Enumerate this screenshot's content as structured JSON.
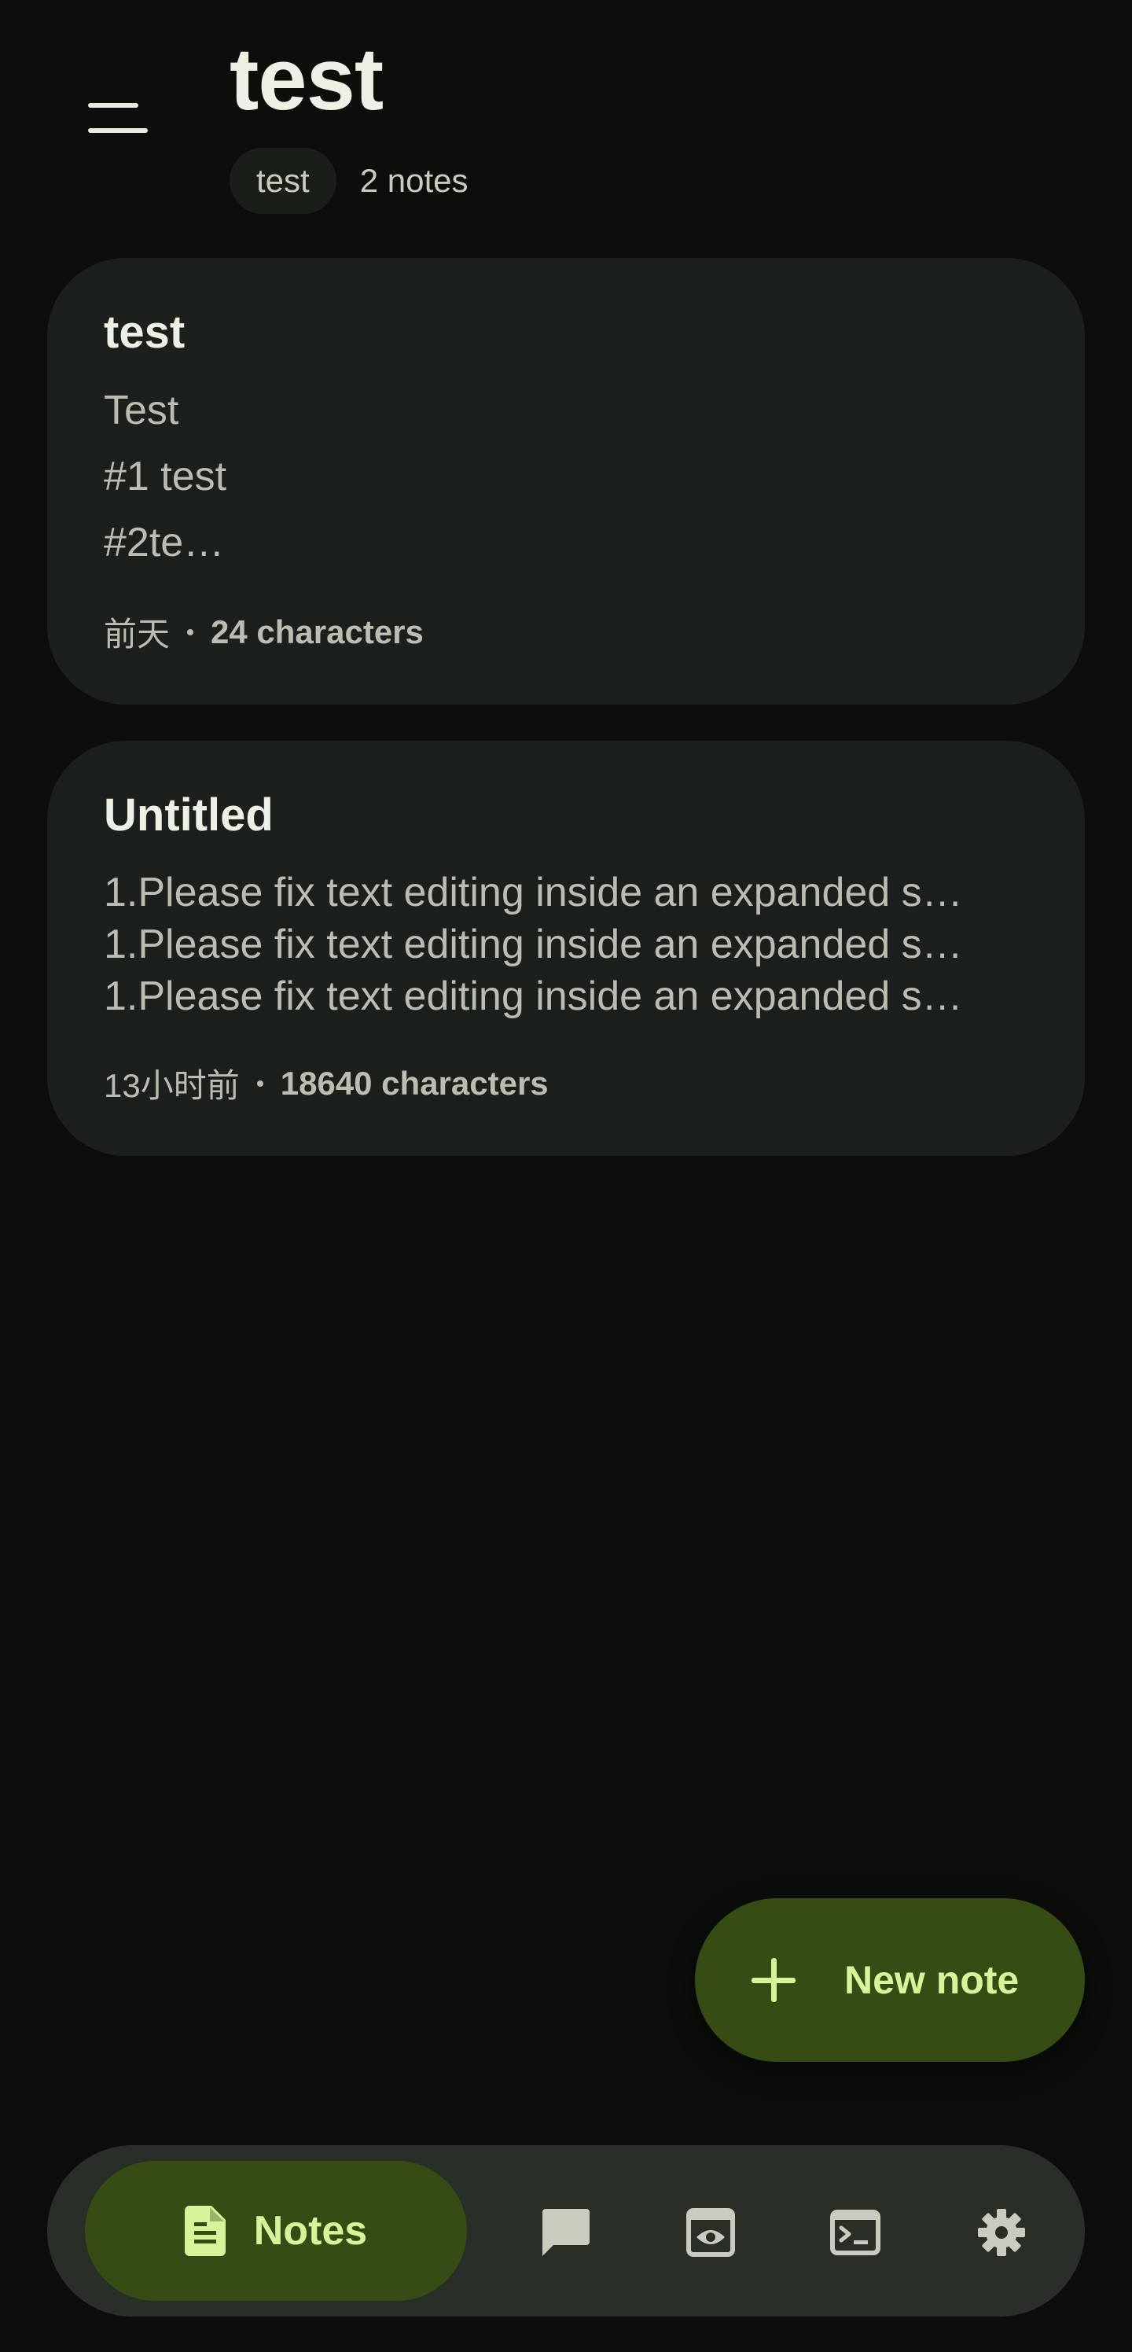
{
  "header": {
    "title": "test",
    "tag": "test",
    "count": "2 notes"
  },
  "notes": [
    {
      "title": "test",
      "preview": [
        "Test",
        "#1 test",
        "#2te…"
      ],
      "date": "前天",
      "chars": "24 characters"
    },
    {
      "title": "Untitled",
      "preview": [
        "1.Please fix text editing inside an expanded s…",
        "1.Please fix text editing inside an expanded s…",
        "1.Please fix text editing inside an expanded s…"
      ],
      "date": "13小时前",
      "chars": "18640 characters"
    }
  ],
  "fab": {
    "label": "New note"
  },
  "nav": {
    "active_label": "Notes",
    "items": [
      "notes-icon",
      "chat-icon",
      "preview-icon",
      "terminal-icon",
      "settings-icon"
    ]
  },
  "colors": {
    "background": "#0b0e0a",
    "card": "#1c201c",
    "accent_container": "#364c14",
    "accent_on": "#d6f59a"
  }
}
